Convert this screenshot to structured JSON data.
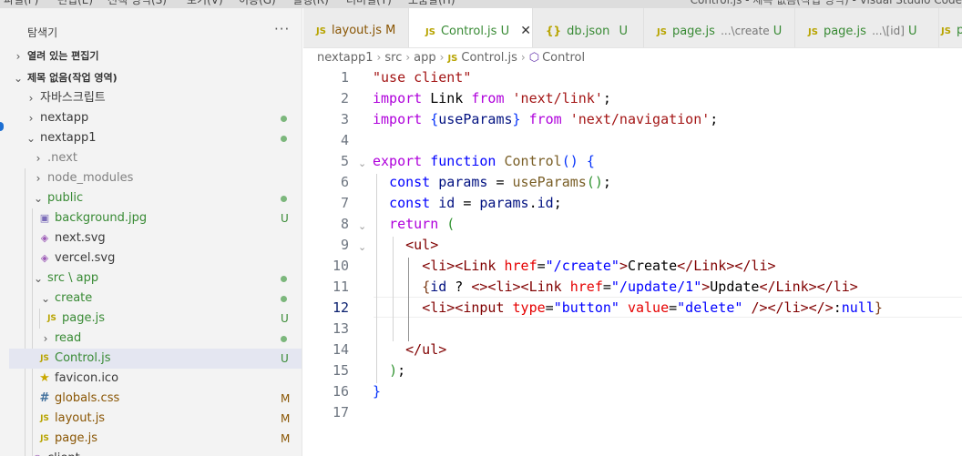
{
  "menubar": {
    "items": [
      "파일(F)",
      "편집(E)",
      "선택 영역(S)",
      "보기(V)",
      "이동(G)",
      "실행(R)",
      "터미널(T)",
      "도움말(H)"
    ],
    "window_title": "Control.js - 제목 없음(작업 영역) - Visual Studio Code"
  },
  "sidebar": {
    "title": "탐색기",
    "more_icon": "ellipsis-icon",
    "open_editors_label": "열려 있는 편집기",
    "workspace_label": "제목 없음(작업 영역)",
    "tree": [
      {
        "label": "자바스크립트",
        "type": "folder",
        "expanded": false,
        "badge": ""
      },
      {
        "label": "nextapp",
        "type": "folder",
        "expanded": false,
        "badge": "dot"
      },
      {
        "label": "nextapp1",
        "type": "folder",
        "expanded": true,
        "badge": "dot"
      },
      {
        "label": ".next",
        "type": "folder",
        "expanded": false,
        "badge": "",
        "dim": true
      },
      {
        "label": "node_modules",
        "type": "folder",
        "expanded": false,
        "badge": "",
        "dim": true
      },
      {
        "label": "public",
        "type": "folder",
        "expanded": true,
        "badge": "dot"
      },
      {
        "label": "background.jpg",
        "type": "file",
        "icon": "image-icon",
        "badge": "U"
      },
      {
        "label": "next.svg",
        "type": "file",
        "icon": "svg-icon",
        "badge": ""
      },
      {
        "label": "vercel.svg",
        "type": "file",
        "icon": "svg-icon",
        "badge": ""
      },
      {
        "label": "src \\ app",
        "type": "folder",
        "expanded": true,
        "badge": "dot"
      },
      {
        "label": "create",
        "type": "folder",
        "expanded": true,
        "badge": "dot"
      },
      {
        "label": "page.js",
        "type": "file",
        "icon": "js-icon",
        "badge": "U"
      },
      {
        "label": "read",
        "type": "folder",
        "expanded": false,
        "badge": "dot"
      },
      {
        "label": "Control.js",
        "type": "file",
        "icon": "js-icon",
        "badge": "U",
        "selected": true
      },
      {
        "label": "favicon.ico",
        "type": "file",
        "icon": "star-icon",
        "badge": ""
      },
      {
        "label": "globals.css",
        "type": "file",
        "icon": "css-icon",
        "badge": "M"
      },
      {
        "label": "layout.js",
        "type": "file",
        "icon": "js-icon",
        "badge": "M"
      },
      {
        "label": "page.js",
        "type": "file",
        "icon": "js-icon",
        "badge": "M"
      }
    ],
    "partial_last": "client"
  },
  "tabs": [
    {
      "icon": "JS",
      "label": "layout.js",
      "desc": "",
      "status": "M",
      "active": false
    },
    {
      "icon": "JS",
      "label": "Control.js",
      "desc": "",
      "status": "U",
      "active": true
    },
    {
      "icon": "{}",
      "label": "db.json",
      "desc": "",
      "status": "U",
      "active": false
    },
    {
      "icon": "JS",
      "label": "page.js",
      "desc": "...\\create",
      "status": "U",
      "active": false
    },
    {
      "icon": "JS",
      "label": "page.js",
      "desc": "...\\[id]",
      "status": "U",
      "active": false
    },
    {
      "icon": "JS",
      "label": "p",
      "desc": "",
      "status": "",
      "active": false
    }
  ],
  "breadcrumb": [
    "nextapp1",
    "src",
    "app",
    "Control.js",
    "Control"
  ],
  "editor": {
    "current_line": 12,
    "line_numbers": [
      "1",
      "2",
      "3",
      "4",
      "5",
      "6",
      "7",
      "8",
      "9",
      "10",
      "11",
      "12",
      "13",
      "14",
      "15",
      "16",
      "17"
    ]
  },
  "colors": {
    "git_added": "#388a34",
    "git_modified": "#895503",
    "selection": "#e4e6f1",
    "js_icon": "#b8a400"
  }
}
